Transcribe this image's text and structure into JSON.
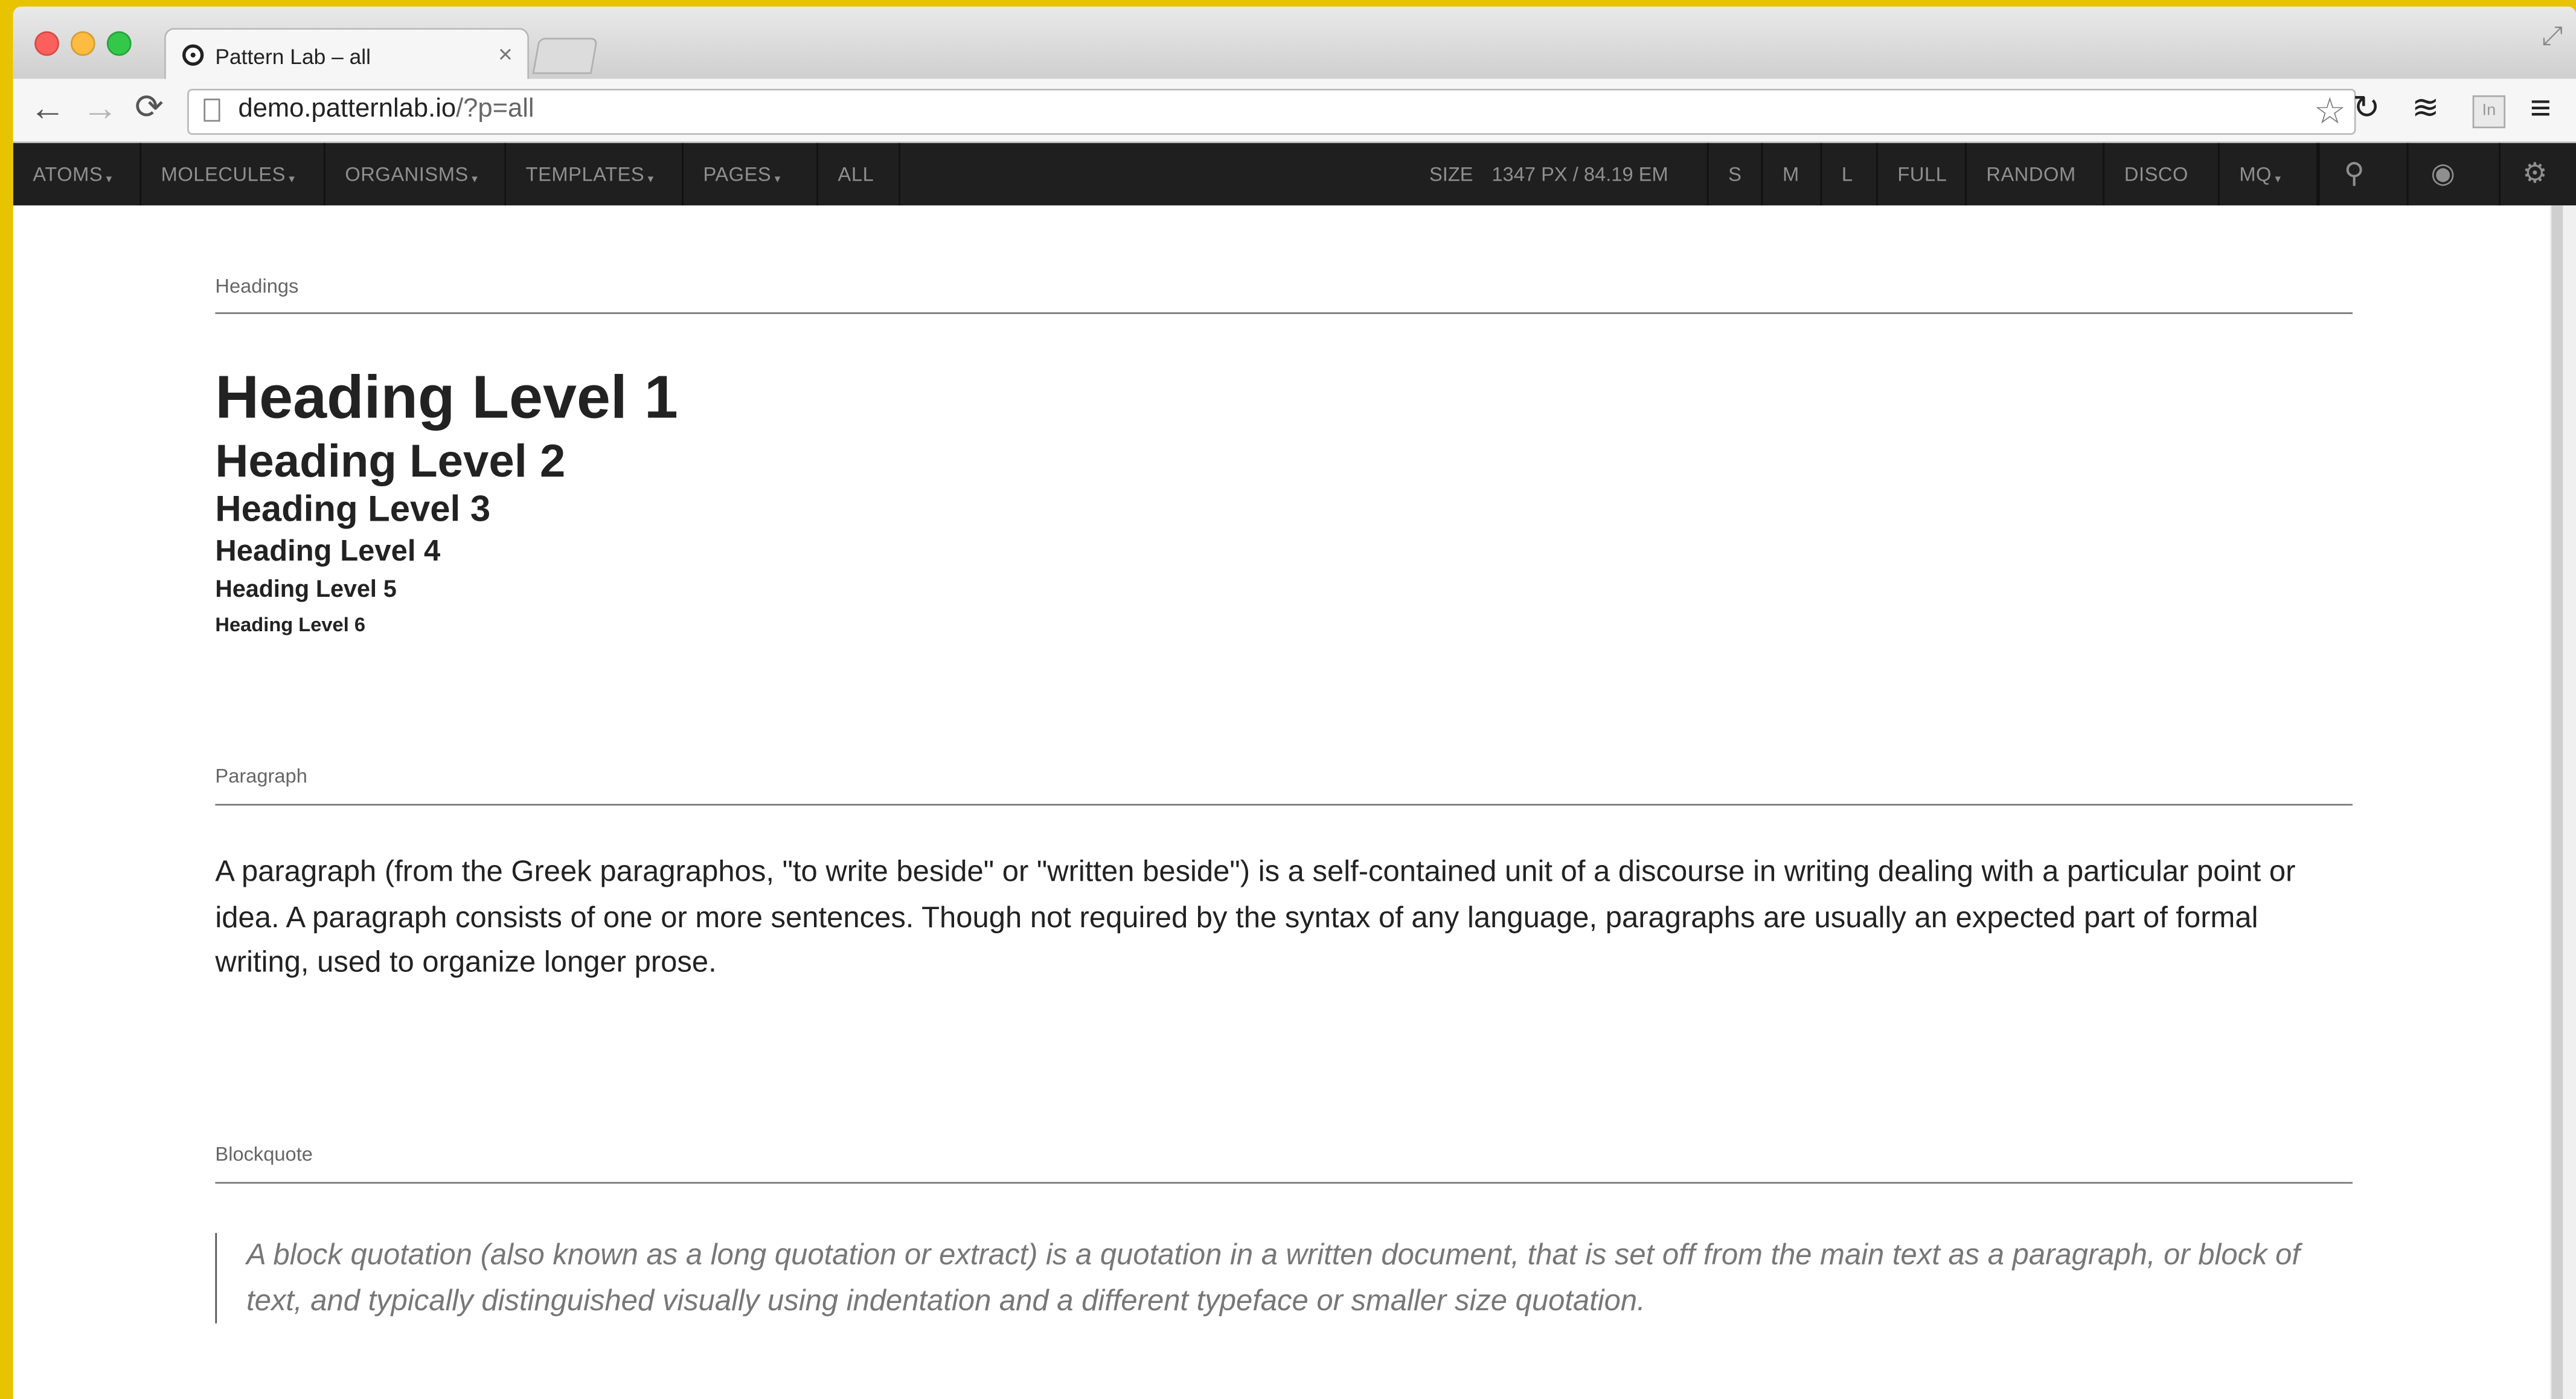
{
  "browser": {
    "tab_title": "Pattern Lab – all",
    "tab_close": "×",
    "url_host": "demo.patternlab.io",
    "url_path": "/?p=all",
    "icons": {
      "back": "←",
      "forward": "→",
      "reload": "⟳",
      "star": "☆",
      "ext_sync": "↻",
      "ext_layers": "≋",
      "ext_in": "In",
      "menu": "≡",
      "fullscreen": "⤢"
    }
  },
  "patternlab_nav": {
    "menus": [
      {
        "label": "ATOMS",
        "caret": "▾"
      },
      {
        "label": "MOLECULES",
        "caret": "▾"
      },
      {
        "label": "ORGANISMS",
        "caret": "▾"
      },
      {
        "label": "TEMPLATES",
        "caret": "▾"
      },
      {
        "label": "PAGES",
        "caret": "▾"
      }
    ],
    "all_label": "ALL",
    "size_label": "SIZE",
    "size_px": "1347 PX",
    "size_separator": " / ",
    "size_em": "84.19 EM",
    "size_buttons": [
      "S",
      "M",
      "L",
      "FULL",
      "RANDOM",
      "DISCO"
    ],
    "mq_label": "MQ",
    "mq_caret": "▾",
    "icons": {
      "search": "⚲",
      "eye": "◉",
      "gear": "⚙"
    }
  },
  "content": {
    "headings_section": {
      "label": "Headings",
      "h1": "Heading Level 1",
      "h2": "Heading Level 2",
      "h3": "Heading Level 3",
      "h4": "Heading Level 4",
      "h5": "Heading Level 5",
      "h6": "Heading Level 6"
    },
    "paragraph_section": {
      "label": "Paragraph",
      "text": "A paragraph (from the Greek paragraphos, \"to write beside\" or \"written beside\") is a self-contained unit of a discourse in writing dealing with a particular point or idea. A paragraph consists of one or more sentences. Though not required by the syntax of any language, paragraphs are usually an expected part of formal writing, used to organize longer prose."
    },
    "blockquote_section": {
      "label": "Blockquote",
      "text": "A block quotation (also known as a long quotation or extract) is a quotation in a written document, that is set off from the main text as a paragraph, or block of text, and typically distinguished visually using indentation and a different typeface or smaller size quotation."
    }
  },
  "colors": {
    "desktop": "#e8c400",
    "nav_background": "#1f1f1f",
    "nav_text": "#8f8f8f"
  }
}
